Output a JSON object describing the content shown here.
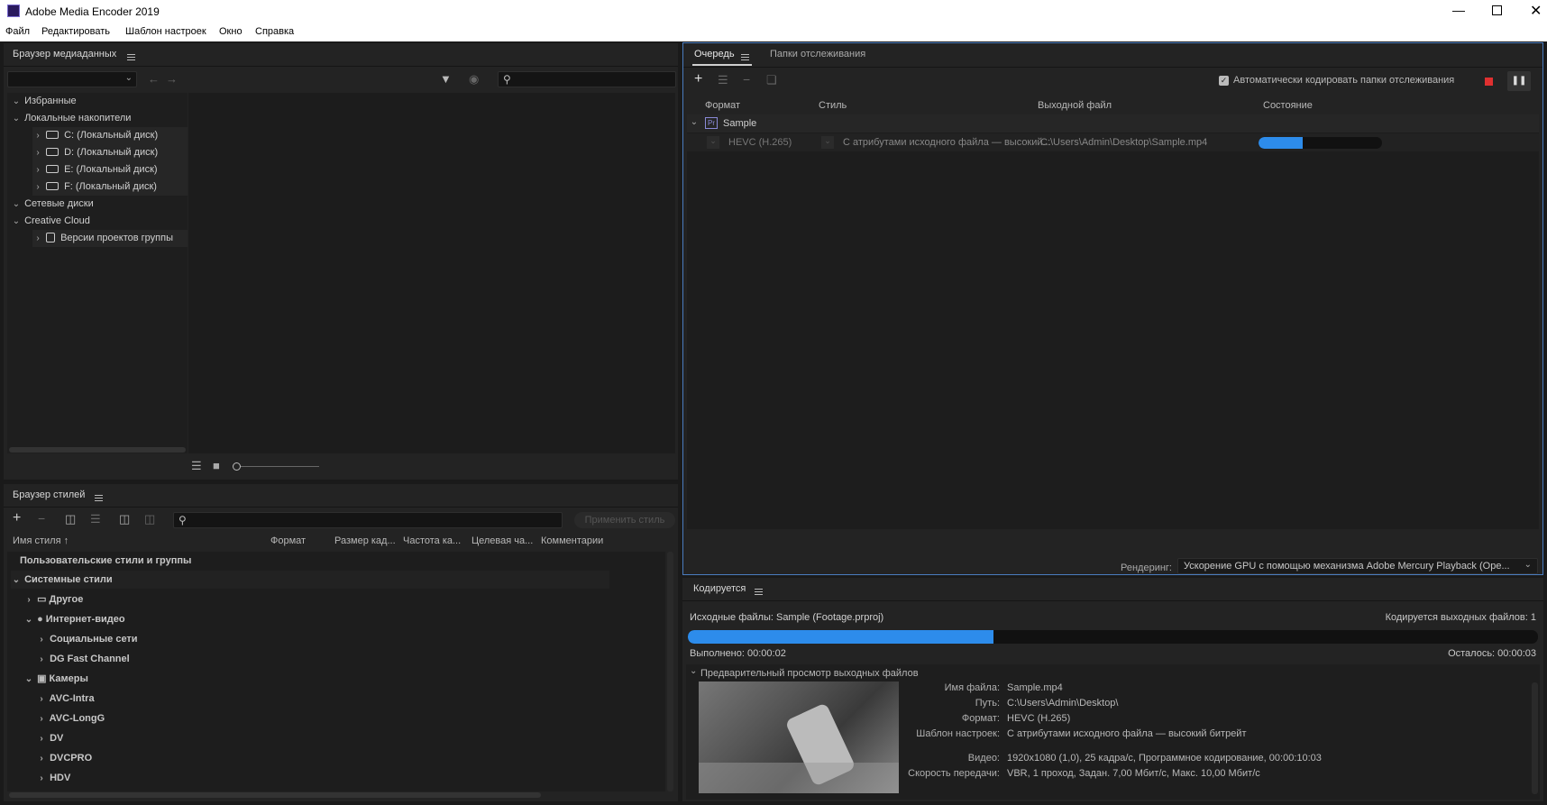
{
  "window": {
    "title": "Adobe Media Encoder 2019"
  },
  "menu": [
    "Файл",
    "Редактировать",
    "Шаблон настроек",
    "Окно",
    "Справка"
  ],
  "media_browser": {
    "title": "Браузер медиаданных",
    "tree": [
      {
        "label": "Избранные",
        "kind": "group"
      },
      {
        "label": "Локальные накопители",
        "kind": "group"
      },
      {
        "label": "C: (Локальный диск)",
        "kind": "drive"
      },
      {
        "label": "D: (Локальный диск)",
        "kind": "drive"
      },
      {
        "label": "E: (Локальный диск)",
        "kind": "drive"
      },
      {
        "label": "F: (Локальный диск)",
        "kind": "drive"
      },
      {
        "label": "Сетевые диски",
        "kind": "group"
      },
      {
        "label": "Creative Cloud",
        "kind": "group"
      },
      {
        "label": "Версии проектов группы",
        "kind": "item"
      }
    ]
  },
  "style_browser": {
    "title": "Браузер стилей",
    "apply_button": "Применить стиль",
    "columns": [
      "Имя стиля",
      "Формат",
      "Размер кад...",
      "Частота ка...",
      "Целевая ча...",
      "Комментарии"
    ],
    "rows": [
      {
        "label": "Пользовательские стили и группы",
        "level": 0,
        "chevron": ""
      },
      {
        "label": "Системные стили",
        "level": 0,
        "chevron": "open"
      },
      {
        "label": "Другое",
        "level": 1,
        "chevron": "closed",
        "icon": "monitor-icon"
      },
      {
        "label": "Интернет-видео",
        "level": 1,
        "chevron": "open",
        "icon": "globe-icon"
      },
      {
        "label": "Социальные сети",
        "level": 2,
        "chevron": "closed"
      },
      {
        "label": "DG Fast Channel",
        "level": 2,
        "chevron": "closed"
      },
      {
        "label": "Камеры",
        "level": 1,
        "chevron": "open",
        "icon": "camera-icon"
      },
      {
        "label": "AVC-Intra",
        "level": 2,
        "chevron": "closed"
      },
      {
        "label": "AVC-LongG",
        "level": 2,
        "chevron": "closed"
      },
      {
        "label": "DV",
        "level": 2,
        "chevron": "closed"
      },
      {
        "label": "DVCPRO",
        "level": 2,
        "chevron": "closed"
      },
      {
        "label": "HDV",
        "level": 2,
        "chevron": "closed"
      }
    ]
  },
  "queue": {
    "tab_queue": "Очередь",
    "tab_watch": "Папки отслеживания",
    "auto_encode": "Автоматически кодировать папки отслеживания",
    "auto_encode_checked": true,
    "columns": [
      "Формат",
      "Стиль",
      "Выходной файл",
      "Состояние"
    ],
    "item": {
      "badge": "Pr",
      "name": "Sample",
      "format": "HEVC (H.265)",
      "style": "С атрибутами исходного файла — высокий...",
      "output": "C:\\Users\\Admin\\Desktop\\Sample.mp4",
      "progress": 0.36
    },
    "render_label": "Рендеринг:",
    "render_value": "Ускорение GPU с помощью механизма Adobe Mercury Playback (Ope..."
  },
  "encoding": {
    "title": "Кодируется",
    "source": "Исходные файлы: Sample (Footage.prproj)",
    "count": "Кодируется выходных файлов: 1",
    "progress": 0.36,
    "elapsed": "Выполнено: 00:00:02",
    "remaining": "Осталось: 00:00:03",
    "preview_title": "Предварительный просмотр выходных файлов",
    "details": [
      {
        "label": "Имя файла:",
        "value": "Sample.mp4"
      },
      {
        "label": "Путь:",
        "value": "C:\\Users\\Admin\\Desktop\\"
      },
      {
        "label": "Формат:",
        "value": "HEVC (H.265)"
      },
      {
        "label": "Шаблон настроек:",
        "value": "С атрибутами исходного файла — высокий битрейт"
      },
      {
        "label": "Видео:",
        "value": "1920x1080 (1,0), 25 кадра/с, Программное кодирование, 00:00:10:03"
      },
      {
        "label": "Скорость передачи:",
        "value": "VBR, 1 проход, Задан. 7,00 Мбит/с, Макс. 10,00 Мбит/с"
      }
    ]
  },
  "colors": {
    "accent": "#2d8ceb",
    "stop": "#e03030",
    "panel": "#232323",
    "focus_border": "#4a7cbf"
  }
}
